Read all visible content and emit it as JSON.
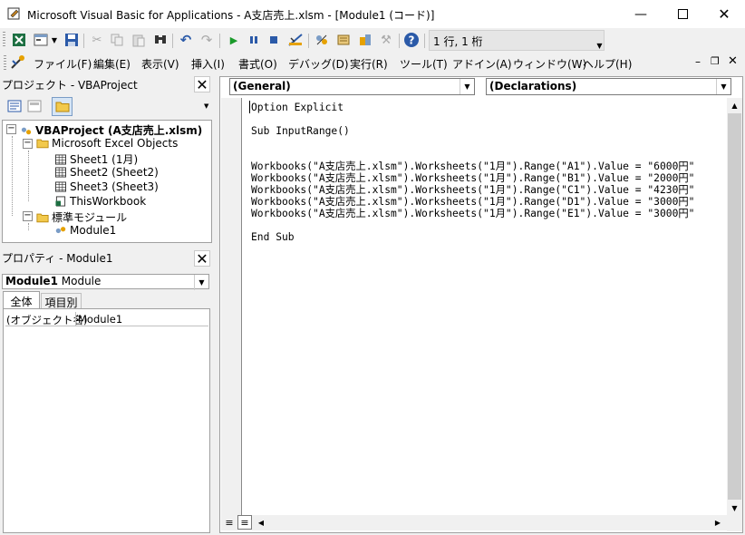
{
  "window": {
    "title": "Microsoft Visual Basic for Applications - A支店売上.xlsm - [Module1 (コード)]"
  },
  "toolbar": {
    "position": "1 行, 1 桁"
  },
  "menu": [
    "ファイル(F)",
    "編集(E)",
    "表示(V)",
    "挿入(I)",
    "書式(O)",
    "デバッグ(D)",
    "実行(R)",
    "ツール(T)",
    "アドイン(A)",
    "ウィンドウ(W)",
    "ヘルプ(H)"
  ],
  "project": {
    "title": "プロジェクト - VBAProject",
    "root": "VBAProject (A支店売上.xlsm)",
    "excel_objects": "Microsoft Excel Objects",
    "sheets": [
      "Sheet1 (1月)",
      "Sheet2 (Sheet2)",
      "Sheet3 (Sheet3)",
      "ThisWorkbook"
    ],
    "modules_folder": "標準モジュール",
    "module": "Module1"
  },
  "properties": {
    "title": "プロパティ - Module1",
    "object_name": "Module1",
    "object_type": "Module",
    "tabs": [
      "全体",
      "項目別"
    ],
    "row_name": "(オブジェクト名)",
    "row_value": "Module1"
  },
  "code": {
    "object_combo": "(General)",
    "proc_combo": "(Declarations)",
    "lines": [
      "Option Explicit",
      "",
      "Sub InputRange()",
      "",
      "",
      "Workbooks(\"A支店売上.xlsm\").Worksheets(\"1月\").Range(\"A1\").Value = \"6000円\"",
      "Workbooks(\"A支店売上.xlsm\").Worksheets(\"1月\").Range(\"B1\").Value = \"2000円\"",
      "Workbooks(\"A支店売上.xlsm\").Worksheets(\"1月\").Range(\"C1\").Value = \"4230円\"",
      "Workbooks(\"A支店売上.xlsm\").Worksheets(\"1月\").Range(\"D1\").Value = \"3000円\"",
      "Workbooks(\"A支店売上.xlsm\").Worksheets(\"1月\").Range(\"E1\").Value = \"3000円\"",
      "",
      "End Sub"
    ]
  }
}
